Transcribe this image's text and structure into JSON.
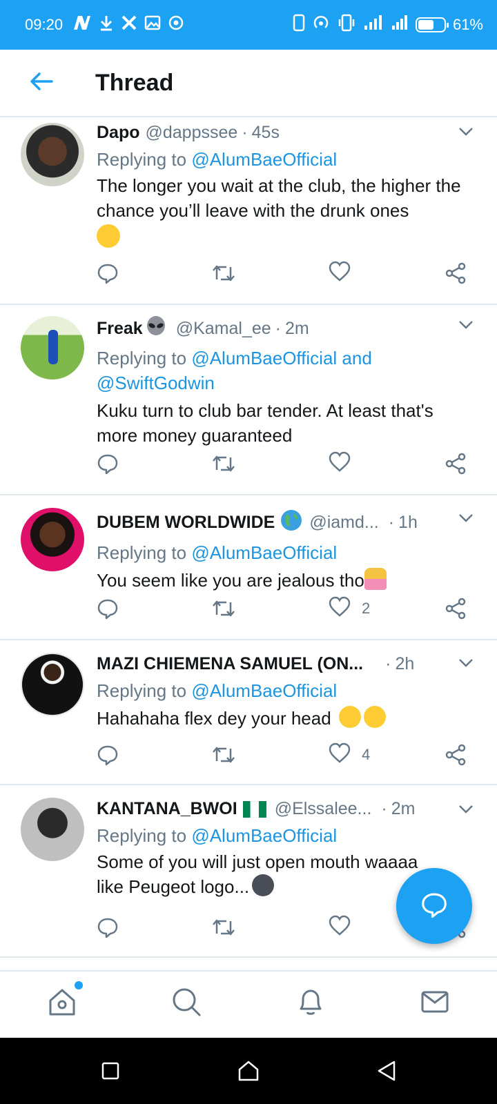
{
  "status_bar": {
    "time": "09:20",
    "battery_text": "61%",
    "battery_level": 0.61,
    "notification_icons": [
      "n-app-icon",
      "download-icon",
      "x-app-icon",
      "image-icon",
      "record-icon"
    ],
    "right_icons": [
      "phone-icon",
      "hotspot-icon",
      "vibrate-icon",
      "signal-icon",
      "signal-icon",
      "battery-icon"
    ]
  },
  "header": {
    "title": "Thread",
    "back_icon": "back-arrow-icon",
    "accent_color": "#1da1f2"
  },
  "tweets": [
    {
      "name": "Dapo",
      "handle": "@dappssee",
      "dot": "·",
      "time": "45s",
      "replying_prefix": "Replying to ",
      "replying_to": "@AlumBaeOfficial",
      "replying_to_2": "",
      "text": "The longer you wait at the club, the higher the chance you’ll leave with the drunk ones",
      "emoji": "winking-tongue-emoji",
      "like_count": ""
    },
    {
      "name": "Freak",
      "name_emoji": "alien-emoji",
      "handle": "@Kamal_ee",
      "dot": "·",
      "time": "2m",
      "replying_prefix": "Replying to ",
      "replying_to": "@AlumBaeOfficial and",
      "replying_to_2": "@SwiftGodwin",
      "text": "Kuku turn to club bar tender. At least that's more money guaranteed",
      "like_count": ""
    },
    {
      "name": "DUBEM WORLDWIDE",
      "name_emoji": "globe-emoji",
      "handle": "@iamd...",
      "dot": "·",
      "time": "1h",
      "replying_prefix": "Replying to ",
      "replying_to": "@AlumBaeOfficial",
      "replying_to_2": "",
      "text": "You seem like you are jealous tho",
      "emoji": "shrugging-emoji",
      "like_count": "2"
    },
    {
      "name": "MAZI CHIEMENA SAMUEL (ON...",
      "handle": "",
      "dot": "·",
      "time": "2h",
      "replying_prefix": "Replying to ",
      "replying_to": "@AlumBaeOfficial",
      "replying_to_2": "",
      "text": "Hahahaha flex dey your head",
      "emoji": "tears-of-joy-emoji",
      "like_count": "4"
    },
    {
      "name": "KANTANA_BWOI",
      "name_emoji": "nigeria-flag-emoji",
      "handle": "@Elssalee...",
      "dot": "·",
      "time": "2m",
      "replying_prefix": "Replying to ",
      "replying_to": "@AlumBaeOfficial",
      "replying_to_2": "",
      "text": "Some of you will just open mouth waaaa like Peugeot logo...",
      "emoji": "neutral-face-emoji",
      "like_count": ""
    }
  ],
  "bottom_nav": [
    "home-icon",
    "search-icon",
    "notifications-icon",
    "messages-icon"
  ],
  "system_nav": [
    "recents-icon",
    "home-button-icon",
    "back-icon"
  ]
}
